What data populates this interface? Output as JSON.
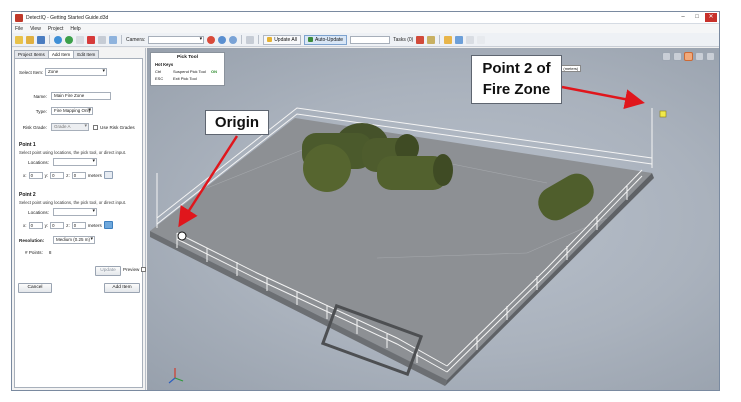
{
  "window": {
    "title": "DetectIQ - Getting Started Guide.d3d",
    "controls": [
      "–",
      "□",
      "✕"
    ]
  },
  "menu": [
    "File",
    "View",
    "Project",
    "Help"
  ],
  "toolbar": {
    "camera_label": "Camera:",
    "camera_value": "",
    "update_all": "Update All",
    "auto_update": "Auto-Update",
    "tasks": "Tasks (0)"
  },
  "left_panel": {
    "tabs": [
      "Project Items",
      "Add Item",
      "Edit Item"
    ],
    "active_tab": "Add Item",
    "select_item_label": "Select Item:",
    "select_item_value": "Zone",
    "name_label": "Name:",
    "name_value": "Main Fire Zone",
    "type_label": "Type:",
    "type_value": "Fire Mapping Only",
    "risk_grade_label": "Risk Grade:",
    "risk_grade_value": "Grade A",
    "use_risk_grades": "Use Risk Grades",
    "point1": {
      "title": "Point 1",
      "desc": "Select point using locations, the pick tool, or direct input.",
      "locations_label": "Locations:",
      "x": "0",
      "y": "0",
      "z": "0",
      "units": "meters"
    },
    "point2": {
      "title": "Point 2",
      "desc": "Select point using locations, the pick tool, or direct input.",
      "locations_label": "Locations:",
      "x": "0",
      "y": "0",
      "z": "0",
      "units": "meters"
    },
    "resolution_label": "Resolution:",
    "resolution_value": "Medium (0.25 m)",
    "points_label": "# Points:",
    "points_value": "8",
    "update_btn": "Update",
    "preview_label": "Preview",
    "cancel_btn": "Cancel",
    "add_item_btn": "Add Item"
  },
  "pick_tool": {
    "title": "Pick Tool",
    "hotkeys": "Hot Keys",
    "rows": [
      {
        "key": "Ctrl",
        "action": "Suspend Pick Tool",
        "state": "ON"
      },
      {
        "key": "ESC",
        "action": "Exit Pick Tool",
        "state": ""
      }
    ]
  },
  "viewport": {
    "coord_readout": "[18.16, 22.1, 4.16] (meters)"
  },
  "annotations": {
    "origin": "Origin",
    "point2_line1": "Point 2 of",
    "point2_line2": "Fire Zone"
  },
  "colors": {
    "arrow": "#e0161c",
    "platform": "#8d9094",
    "tank": "#4b5a2c",
    "accent": "#6fa8dc"
  }
}
